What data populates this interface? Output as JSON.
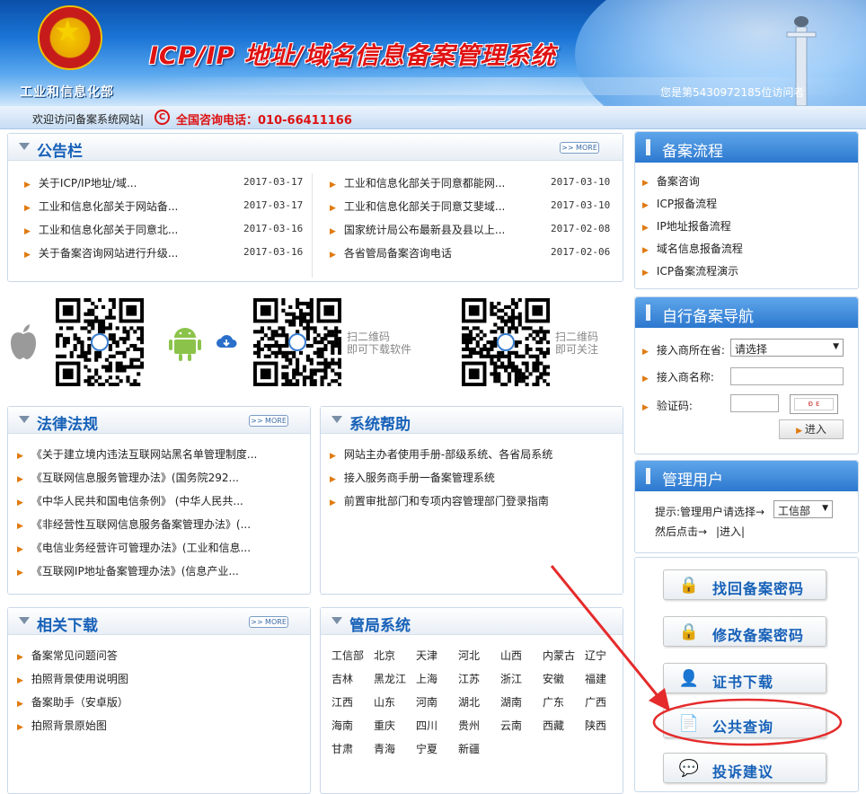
{
  "header": {
    "ministry": "工业和信息化部",
    "title": "ICP/IP 地址/域名信息备案管理系统",
    "visitor_text": "您是第5430972185位访问者"
  },
  "notice": {
    "welcome": "欢迎访问备案系统网站|",
    "phone": "全国咨询电话：010-66411166"
  },
  "bulletin": {
    "title": "公告栏",
    "more": ">> MORE",
    "left": [
      {
        "text": "关于ICP/IP地址/域...",
        "date": "2017-03-17"
      },
      {
        "text": "工业和信息化部关于网站备...",
        "date": "2017-03-17"
      },
      {
        "text": "工业和信息化部关于同意北...",
        "date": "2017-03-16"
      },
      {
        "text": "关于备案咨询网站进行升级...",
        "date": "2017-03-16"
      }
    ],
    "right": [
      {
        "text": "工业和信息化部关于同意都能网...",
        "date": "2017-03-10"
      },
      {
        "text": "工业和信息化部关于同意艾斐域...",
        "date": "2017-03-10"
      },
      {
        "text": "国家统计局公布最新县及县以上...",
        "date": "2017-02-08"
      },
      {
        "text": "各省管局备案咨询电话",
        "date": "2017-02-06"
      }
    ]
  },
  "qr": {
    "download_line1": "扫二维码",
    "download_line2": "即可下载软件",
    "follow_line1": "扫二维码",
    "follow_line2": "即可关注"
  },
  "law": {
    "title": "法律法规",
    "more": ">> MORE",
    "items": [
      "《关于建立境内违法互联网站黑名单管理制度...",
      "《互联网信息服务管理办法》(国务院292...",
      "《中华人民共和国电信条例》 (中华人民共...",
      "《非经营性互联网信息服务备案管理办法》(...",
      "《电信业务经营许可管理办法》(工业和信息...",
      "《互联网IP地址备案管理办法》(信息产业..."
    ]
  },
  "help": {
    "title": "系统帮助",
    "items": [
      "网站主办者使用手册-部级系统、各省局系统",
      "接入服务商手册一备案管理系统",
      "前置审批部门和专项内容管理部门登录指南"
    ]
  },
  "downloads": {
    "title": "相关下载",
    "more": ">> MORE",
    "items": [
      "备案常见问题问答",
      "拍照背景使用说明图",
      "备案助手（安卓版）",
      "拍照背景原始图"
    ]
  },
  "bureaus": {
    "title": "管局系统",
    "rows": [
      [
        "工信部",
        "北京",
        "天津",
        "河北",
        "山西",
        "内蒙古",
        "辽宁"
      ],
      [
        "吉林",
        "黑龙江",
        "上海",
        "江苏",
        "浙江",
        "安徽",
        "福建"
      ],
      [
        "江西",
        "山东",
        "河南",
        "湖北",
        "湖南",
        "广东",
        "广西"
      ],
      [
        "海南",
        "重庆",
        "四川",
        "贵州",
        "云南",
        "西藏",
        "陕西"
      ],
      [
        "甘肃",
        "青海",
        "宁夏",
        "新疆"
      ]
    ]
  },
  "process": {
    "title": "备案流程",
    "items": [
      "备案咨询",
      "ICP报备流程",
      "IP地址报备流程",
      "域名信息报备流程",
      "ICP备案流程演示"
    ]
  },
  "selfnav": {
    "title": "自行备案导航",
    "province_label": "接入商所在省:",
    "province_value": "请选择",
    "name_label": "接入商名称:",
    "captcha_label": "验证码:",
    "captcha_text": "ᴆ ᴇ",
    "enter_label": "进入"
  },
  "admin": {
    "title": "管理用户",
    "hint": "提示:管理用户请选择→",
    "select_value": "工信部",
    "then": "然后点击→",
    "enter_link": "|进入|"
  },
  "actions": [
    {
      "label": "找回备案密码",
      "icon": "lock-icon"
    },
    {
      "label": "修改备案密码",
      "icon": "lock-icon"
    },
    {
      "label": "证书下载",
      "icon": "user-certificate-icon"
    },
    {
      "label": "公共查询",
      "icon": "search-document-icon"
    },
    {
      "label": "投诉建议",
      "icon": "chat-bubble-icon"
    }
  ],
  "colors": {
    "header_blue": "#1a74d6",
    "title_red": "#e01212",
    "link_blue": "#1761b8",
    "annotation_red": "#e52b2b"
  }
}
